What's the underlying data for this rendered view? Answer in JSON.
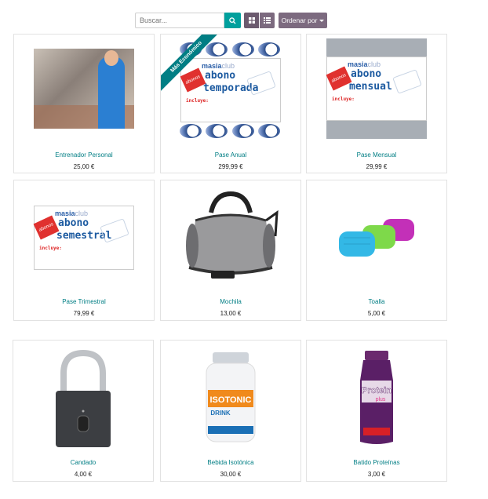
{
  "toolbar": {
    "search_placeholder": "Buscar...",
    "sort_label": "Ordenar por",
    "accent_color": "#00a09d",
    "secondary_color": "#7c6a7f"
  },
  "products": [
    {
      "name": "Entrenador Personal",
      "price": "25,00 €"
    },
    {
      "name": "Pase Anual",
      "price": "299,99 €",
      "ribbon": "Más Económico"
    },
    {
      "name": "Pase Mensual",
      "price": "29,99 €"
    },
    {
      "name": "Pase Trimestral",
      "price": "79,99 €"
    },
    {
      "name": "Mochila",
      "price": "13,00 €"
    },
    {
      "name": "Toalla",
      "price": "5,00 €"
    },
    {
      "name": "Candado",
      "price": "4,00 €"
    },
    {
      "name": "Bebida Isotónica",
      "price": "30,00 €"
    },
    {
      "name": "Batido Proteínas",
      "price": "3,00 €"
    }
  ],
  "pass_graphics": {
    "brand": "masia",
    "brand_suffix": "club",
    "anual": [
      "abono",
      "temporada"
    ],
    "mensual": [
      "abono",
      "mensual"
    ],
    "trimestral": [
      "abono",
      "semestral"
    ],
    "includes": "incluye:",
    "badge": "abonos"
  },
  "bottle_labels": {
    "isotonic": "ISOTONIC",
    "drink": "DRINK",
    "protein": "Protein",
    "plus": "plus"
  }
}
